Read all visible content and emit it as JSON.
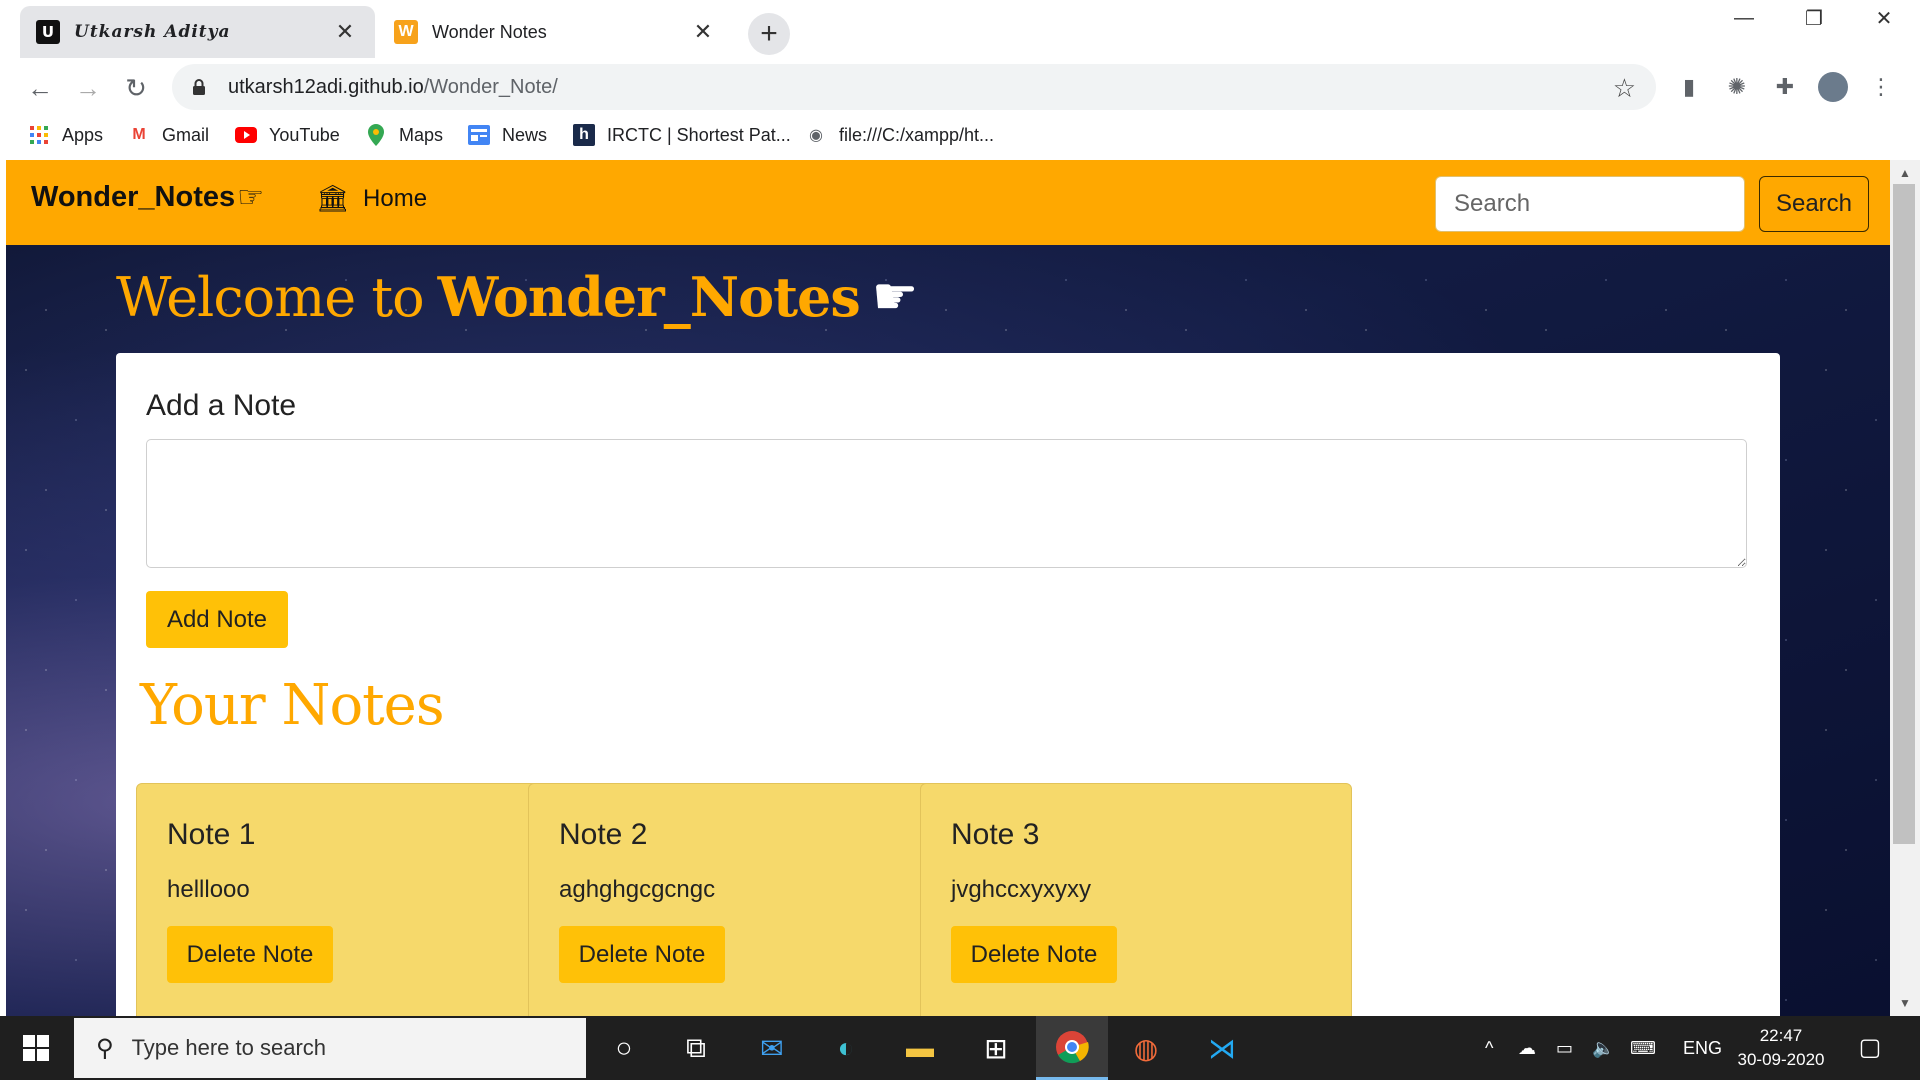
{
  "browser": {
    "tabs": [
      {
        "title": "Utkarsh Aditya",
        "favicon": "U",
        "active": false
      },
      {
        "title": "Wonder Notes",
        "favicon": "W",
        "active": true
      }
    ],
    "url_host": "utkarsh12adi.github.io",
    "url_path": "/Wonder_Note/",
    "bookmarks": [
      {
        "label": "Apps",
        "icon": "apps-grid-icon"
      },
      {
        "label": "Gmail",
        "icon": "gmail-icon"
      },
      {
        "label": "YouTube",
        "icon": "youtube-icon"
      },
      {
        "label": "Maps",
        "icon": "maps-icon"
      },
      {
        "label": "News",
        "icon": "news-icon"
      },
      {
        "label": "IRCTC | Shortest Pat...",
        "icon": "h-icon"
      },
      {
        "label": "file:///C:/xampp/ht...",
        "icon": "globe-icon"
      }
    ]
  },
  "site": {
    "brand": "Wonder_Notes",
    "nav_home": "Home",
    "search_placeholder": "Search",
    "search_button": "Search",
    "welcome_prefix": "Welcome to",
    "welcome_brand": "Wonder_Notes",
    "add_title": "Add a Note",
    "add_button": "Add Note",
    "notes_heading": "Your Notes",
    "notes": [
      {
        "title": "Note 1",
        "text": "helllooo",
        "button": "Delete Note"
      },
      {
        "title": "Note 2",
        "text": "aghghgcgcngc",
        "button": "Delete Note"
      },
      {
        "title": "Note 3",
        "text": "jvghccxyxyxy",
        "button": "Delete Note"
      }
    ],
    "colors": {
      "accent": "#ffa800",
      "button": "#ffc107",
      "card": "#f6d96b"
    }
  },
  "taskbar": {
    "search_placeholder": "Type here to search",
    "language": "ENG",
    "time": "22:47",
    "date": "30-09-2020"
  }
}
